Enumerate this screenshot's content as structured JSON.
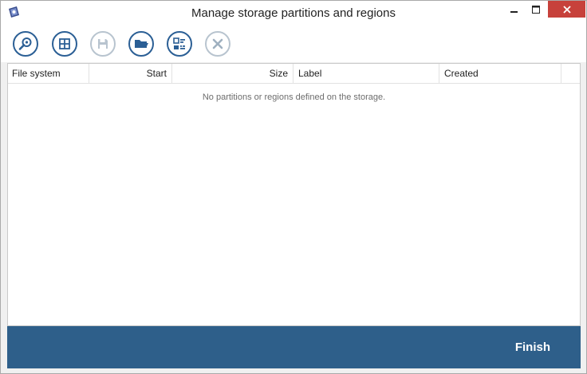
{
  "window": {
    "title": "Manage storage partitions and regions"
  },
  "toolbar": {
    "buttons": [
      {
        "name": "scan-button",
        "icon": "magnifier-icon",
        "enabled": true
      },
      {
        "name": "add-region-button",
        "icon": "grid-icon",
        "enabled": true
      },
      {
        "name": "save-button",
        "icon": "floppy-disk-icon",
        "enabled": false
      },
      {
        "name": "open-button",
        "icon": "folder-open-icon",
        "enabled": true
      },
      {
        "name": "list-view-button",
        "icon": "list-layout-icon",
        "enabled": true
      },
      {
        "name": "delete-button",
        "icon": "x-icon",
        "enabled": false
      }
    ]
  },
  "table": {
    "columns": [
      "File system",
      "Start",
      "Size",
      "Label",
      "Created"
    ],
    "empty_message": "No partitions or regions defined on the storage."
  },
  "footer": {
    "finish_label": "Finish"
  },
  "colors": {
    "accent": "#2b5f95",
    "footer": "#2e5f8a",
    "close_button": "#c7413b"
  }
}
